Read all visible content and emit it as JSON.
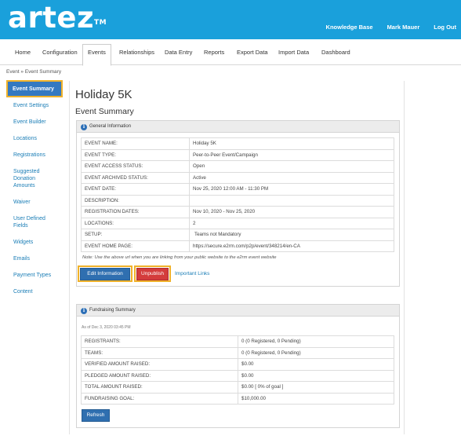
{
  "app": {
    "logo": "artez",
    "logo_tm": "TM"
  },
  "toplinks": [
    "Knowledge Base",
    "Mark Mauer",
    "Log Out"
  ],
  "tabs": [
    "Home",
    "Configuration",
    "Events",
    "Relationships",
    "Data Entry",
    "Reports",
    "Export Data",
    "Import Data",
    "Dashboard"
  ],
  "active_tab": "Events",
  "breadcrumb": "Event » Event Summary",
  "sidebar": {
    "items": [
      "Event Summary",
      "Event Settings",
      "Event Builder",
      "Locations",
      "Registrations",
      "Suggested Donation Amounts",
      "Waiver",
      "User Defined Fields",
      "Widgets",
      "Emails",
      "Payment Types",
      "Content"
    ],
    "active": "Event Summary"
  },
  "page": {
    "title": "Holiday 5K",
    "section": "Event Summary"
  },
  "general": {
    "heading": "General Information",
    "rows": [
      {
        "label": "EVENT NAME:",
        "value": "Holiday 5K"
      },
      {
        "label": "EVENT TYPE:",
        "value": "Peer-to-Peer Event/Campaign"
      },
      {
        "label": "EVENT ACCESS STATUS:",
        "value": "Open"
      },
      {
        "label": "EVENT ARCHIVED STATUS:",
        "value": "Active"
      },
      {
        "label": "EVENT DATE:",
        "value": "Nov 25, 2020 12:00 AM - 11:30 PM"
      },
      {
        "label": "DESCRIPTION:",
        "value": ""
      },
      {
        "label": "REGISTRATION DATES:",
        "value": "Nov 10, 2020 - Nov 25, 2020"
      },
      {
        "label": "LOCATIONS:",
        "value": "2"
      },
      {
        "label": "SETUP:",
        "value": "Teams not Mandatory"
      },
      {
        "label": "EVENT HOME PAGE:",
        "value": "https://secure.e2rm.com/p2p/event/348214/en-CA"
      }
    ],
    "note": "Note: Use the above url when you are linking from your public website to the e2rm event website",
    "buttons": {
      "edit": "Edit Information",
      "unpublish": "Unpublish",
      "links": "Important Links"
    }
  },
  "fundraising": {
    "heading": "Fundraising Summary",
    "as_of": "As of Dec 3, 2020 03:45 PM",
    "rows": [
      {
        "label": "REGISTRANTS:",
        "value": "0   (0 Registered, 0 Pending)"
      },
      {
        "label": "TEAMS:",
        "value": "0   (0 Registered, 0 Pending)"
      },
      {
        "label": "VERIFIED AMOUNT RAISED:",
        "value": "$0.00"
      },
      {
        "label": "PLEDGED AMOUNT RAISED:",
        "value": "$0.00"
      },
      {
        "label": "TOTAL AMOUNT RAISED:",
        "value": "$0.00   [ 0% of goal ]"
      },
      {
        "label": "FUNDRAISING GOAL:",
        "value": "$10,000.00"
      }
    ],
    "refresh": "Refresh"
  },
  "colors": {
    "brand": "#1aa0db",
    "primary_button": "#2f6fb0",
    "danger_button": "#d43c3c",
    "highlight": "#f0b22a"
  }
}
